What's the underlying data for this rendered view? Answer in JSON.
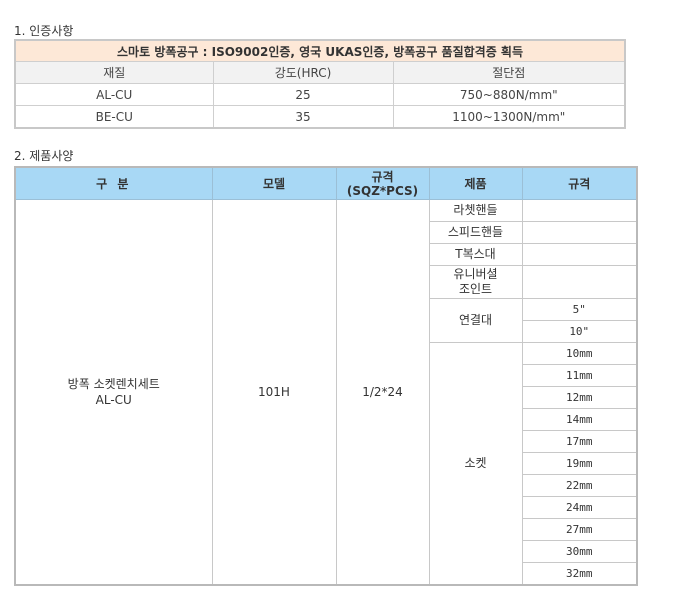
{
  "section1": {
    "title": "1. 인증사항",
    "banner": "스마토 방폭공구 : ISO9002인증, 영국 UKAS인증, 방폭공구 품질합격증 획득",
    "headers": [
      "재질",
      "강도(HRC)",
      "절단점"
    ],
    "rows": [
      [
        "AL-CU",
        "25",
        "750~880N/mm\""
      ],
      [
        "BE-CU",
        "35",
        "1100~1300N/mm\""
      ]
    ]
  },
  "section2": {
    "title": "2. 제품사양",
    "headers": {
      "category": "구 분",
      "model": "모델",
      "spec_line1": "규격",
      "spec_line2": "(SQZ*PCS)",
      "product": "제품",
      "size": "규격"
    },
    "item": {
      "name_line1": "방폭 소켓렌치세트",
      "name_line2": "AL-CU",
      "model": "101H",
      "spec": "1/2*24"
    },
    "products": {
      "ratchet": "라쳇핸들",
      "speed": "스피드핸들",
      "tbar": "T복스대",
      "universal_line1": "유니버셜",
      "universal_line2": "조인트",
      "extension": "연결대",
      "socket": "소켓"
    },
    "extension_sizes": [
      "5\"",
      "10\""
    ],
    "socket_sizes": [
      "10mm",
      "11mm",
      "12mm",
      "14mm",
      "17mm",
      "19mm",
      "22mm",
      "24mm",
      "27mm",
      "30mm",
      "32mm"
    ]
  }
}
